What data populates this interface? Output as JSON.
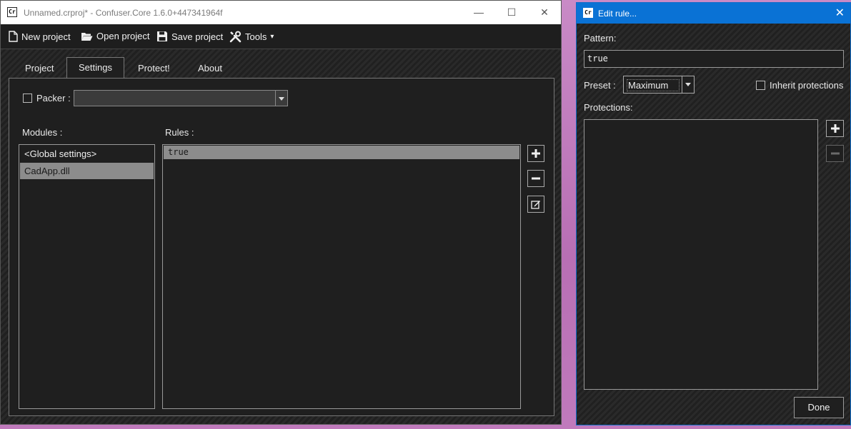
{
  "main_window": {
    "title": "Unnamed.crproj* - Confuser.Core 1.6.0+447341964f",
    "app_icon_text": "Cr",
    "controls": {
      "minimize": "—",
      "maximize": "☐",
      "close": "✕"
    },
    "menu": {
      "new_project": "New project",
      "open_project": "Open project",
      "save_project": "Save project",
      "tools": "Tools",
      "tools_arrow": "▾"
    },
    "tabs": [
      "Project",
      "Settings",
      "Protect!",
      "About"
    ],
    "active_tab": "Settings",
    "settings": {
      "packer_label": "Packer :",
      "packer_value": "",
      "modules_label": "Modules :",
      "rules_label": "Rules :",
      "modules": [
        "<Global settings>",
        "CadApp.dll"
      ],
      "selected_module": "CadApp.dll",
      "rules": [
        "true"
      ],
      "selected_rule": "true"
    }
  },
  "dialog": {
    "title": "Edit rule...",
    "app_icon_text": "Cr",
    "close": "✕",
    "pattern_label": "Pattern:",
    "pattern_value": "true",
    "preset_label": "Preset :",
    "preset_value": "Maximum",
    "inherit_label": "Inherit protections",
    "protections_label": "Protections:",
    "protections": [],
    "done_label": "Done"
  },
  "colors": {
    "window_bg": "#1f1f1f",
    "dialog_title_bar": "#0a72d5",
    "selection": "#8c8c8c",
    "desktop": "#c07abc"
  }
}
